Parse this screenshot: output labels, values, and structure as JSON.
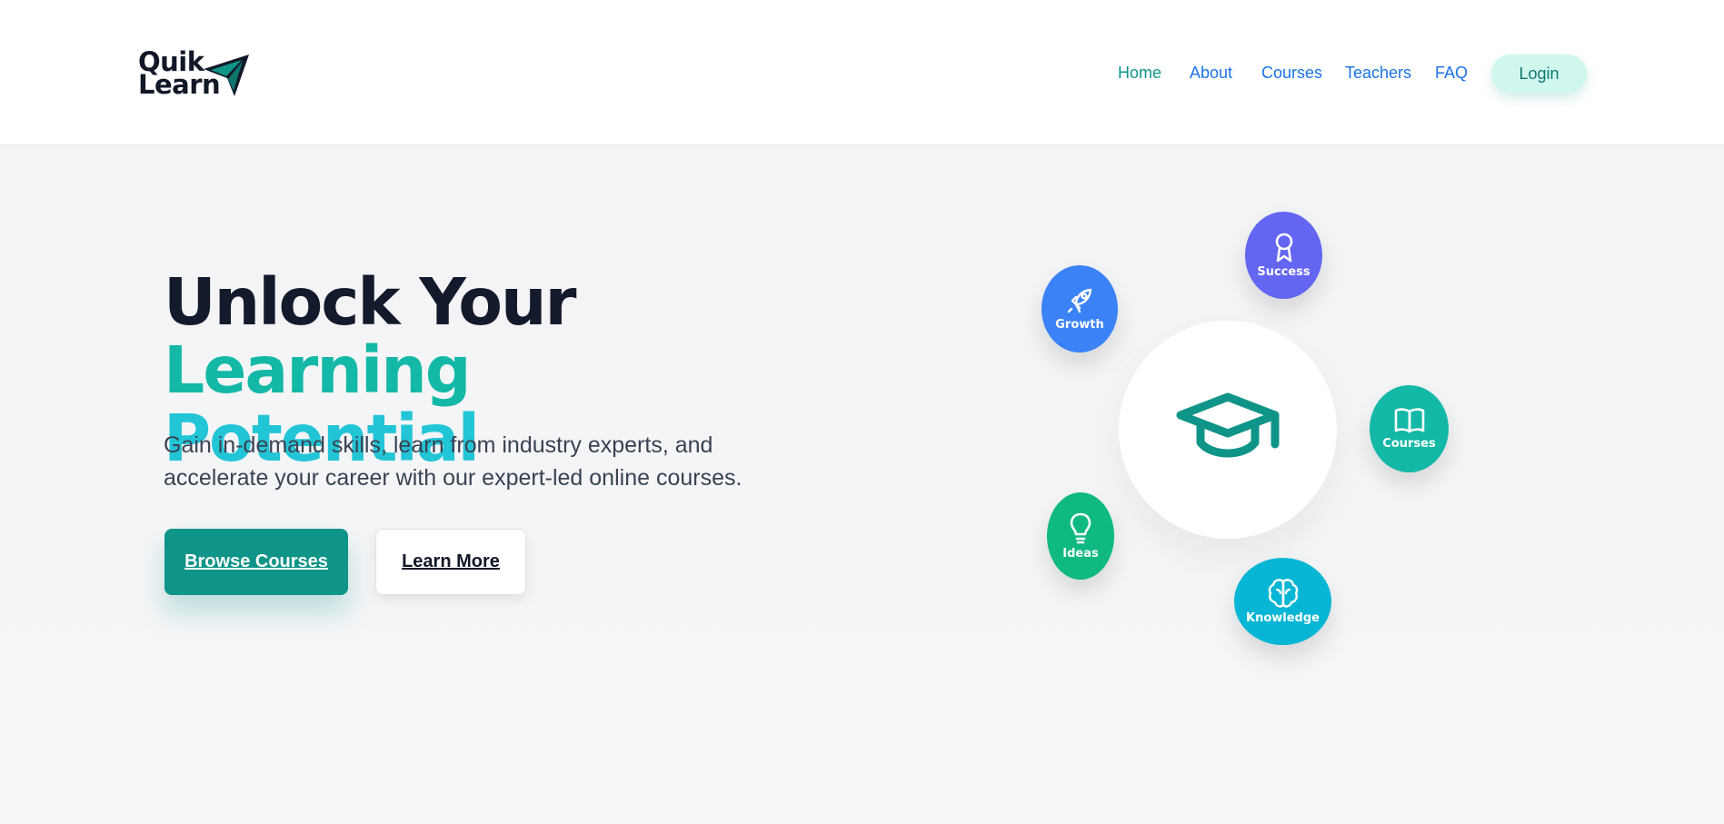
{
  "header": {
    "logo": {
      "line1": "Quik",
      "line2": "Learn"
    },
    "nav": [
      {
        "label": "Home",
        "active": true
      },
      {
        "label": "About"
      },
      {
        "label": "Courses"
      },
      {
        "label": "Teachers"
      },
      {
        "label": "FAQ"
      }
    ],
    "login_label": "Login"
  },
  "hero": {
    "title_part1": "Unlock Your ",
    "title_part2": "Learning",
    "title_part3": "Potential",
    "subtitle": "Gain in-demand skills, learn from industry experts, and accelerate your career with our expert-led online courses.",
    "primary_button": "Browse Courses",
    "secondary_button": "Learn More"
  },
  "visual": {
    "center_icon": "graduation-cap-icon",
    "bubbles": [
      {
        "label": "Success",
        "icon": "award-icon",
        "color": "#6366f1"
      },
      {
        "label": "Growth",
        "icon": "rocket-icon",
        "color": "#3b82f6"
      },
      {
        "label": "Courses",
        "icon": "book-icon",
        "color": "#14b8a6"
      },
      {
        "label": "Ideas",
        "icon": "lightbulb-icon",
        "color": "#10b981"
      },
      {
        "label": "Knowledge",
        "icon": "brain-icon",
        "color": "#06b6d4"
      }
    ]
  },
  "colors": {
    "brand_teal": "#0f9488",
    "nav_link": "#1a73e8",
    "heading": "#131a2b"
  }
}
